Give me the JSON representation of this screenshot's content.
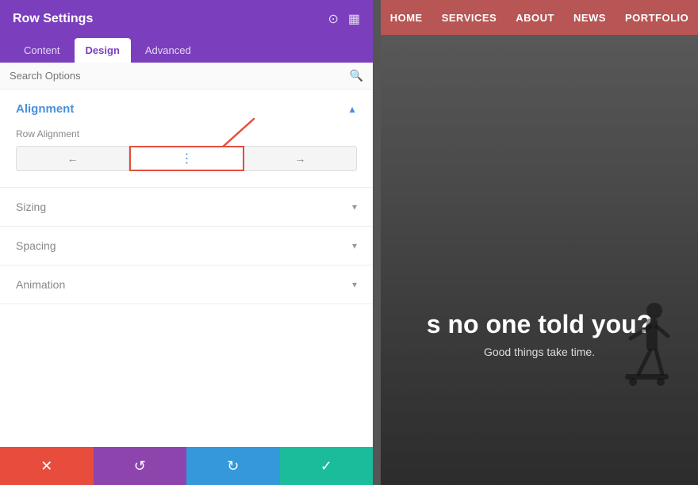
{
  "panel": {
    "title": "Row Settings",
    "tabs": [
      {
        "label": "Content",
        "active": false
      },
      {
        "label": "Design",
        "active": true
      },
      {
        "label": "Advanced",
        "active": false
      }
    ],
    "search_placeholder": "Search Options",
    "sections": [
      {
        "id": "alignment",
        "label": "Alignment",
        "color": "blue",
        "expanded": true,
        "fields": [
          {
            "label": "Row Alignment",
            "options": [
              {
                "icon": "←",
                "active": false
              },
              {
                "icon": "⋮",
                "active": true
              },
              {
                "icon": "→",
                "active": false
              }
            ]
          }
        ]
      },
      {
        "id": "sizing",
        "label": "Sizing",
        "expanded": false
      },
      {
        "id": "spacing",
        "label": "Spacing",
        "expanded": false
      },
      {
        "id": "animation",
        "label": "Animation",
        "expanded": false
      }
    ],
    "footer_buttons": [
      {
        "id": "cancel",
        "icon": "✕",
        "color": "red"
      },
      {
        "id": "undo",
        "icon": "↺",
        "color": "purple"
      },
      {
        "id": "redo",
        "icon": "↻",
        "color": "blue"
      },
      {
        "id": "save",
        "icon": "✓",
        "color": "teal"
      }
    ]
  },
  "nav": {
    "items": [
      "HOME",
      "SERVICES",
      "ABOUT",
      "NEWS",
      "PORTFOLIO"
    ]
  },
  "hero": {
    "main_text": "s no one told you?",
    "sub_text": "Good things take time."
  }
}
